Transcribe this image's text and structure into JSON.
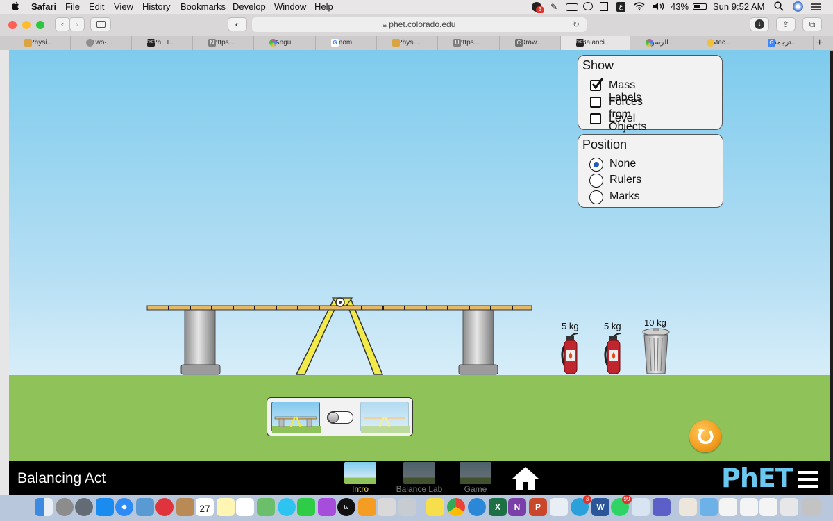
{
  "menubar": {
    "app": "Safari",
    "menus": [
      "File",
      "Edit",
      "View",
      "History",
      "Bookmarks",
      "Develop",
      "Window",
      "Help"
    ],
    "badge_count": "3",
    "battery": "43%",
    "clock": "Sun 9:52 AM"
  },
  "browser": {
    "url": "phet.colorado.edu",
    "tabs": [
      {
        "label": "Physi...",
        "favicon_color": "#d9a441"
      },
      {
        "label": "Two-...",
        "favicon_color": "#8e8e8e"
      },
      {
        "label": "PhET...",
        "favicon_color": "#222222"
      },
      {
        "label": "https...",
        "favicon_color": "#7f7f7f"
      },
      {
        "label": "Angu...",
        "favicon_color": "#e44d8a"
      },
      {
        "label": "mom...",
        "favicon_color": "#4285f4"
      },
      {
        "label": "Physi...",
        "favicon_color": "#d9a441"
      },
      {
        "label": "https...",
        "favicon_color": "#7f7f7f"
      },
      {
        "label": "Draw...",
        "favicon_color": "#6f6f6f"
      },
      {
        "label": "Balanci...",
        "favicon_color": "#222222"
      },
      {
        "label": "الرسو...",
        "favicon_color": "#e44d8a"
      },
      {
        "label": "Mec...",
        "favicon_color": "#f0c040"
      },
      {
        "label": "ترجمة...",
        "favicon_color": "#4285f4"
      }
    ],
    "active_tab_index": 9,
    "tab_letters": [
      "I",
      "",
      "PhET",
      "N",
      "",
      "G",
      "I",
      "U",
      "C",
      "PhET",
      "",
      "",
      "G"
    ]
  },
  "sim": {
    "show_panel": {
      "title": "Show",
      "options": [
        {
          "label": "Mass Labels",
          "checked": true
        },
        {
          "label": "Forces from Objects",
          "checked": false
        },
        {
          "label": "Level",
          "checked": false
        }
      ]
    },
    "position_panel": {
      "title": "Position",
      "options": [
        {
          "label": "None",
          "selected": true
        },
        {
          "label": "Rulers",
          "selected": false
        },
        {
          "label": "Marks",
          "selected": false
        }
      ]
    },
    "masses": [
      {
        "label": "5 kg",
        "object": "fire-extinguisher"
      },
      {
        "label": "5 kg",
        "object": "fire-extinguisher"
      },
      {
        "label": "10 kg",
        "object": "trash-can"
      }
    ],
    "supports_toggle": {
      "state": "supports-on"
    },
    "colors": {
      "accent": "#f39c1e",
      "plank": "#e3b866",
      "fulcrum": "#f2e94a",
      "ground": "#8fc35a"
    }
  },
  "nav": {
    "sim_title": "Balancing Act",
    "screens": [
      {
        "label": "Intro",
        "active": true
      },
      {
        "label": "Balance Lab",
        "active": false
      },
      {
        "label": "Game",
        "active": false
      }
    ],
    "brand": "PhET"
  },
  "dock": {
    "calendar_date": "27",
    "telegram_badge": "3",
    "whatsapp_badge": "99"
  }
}
